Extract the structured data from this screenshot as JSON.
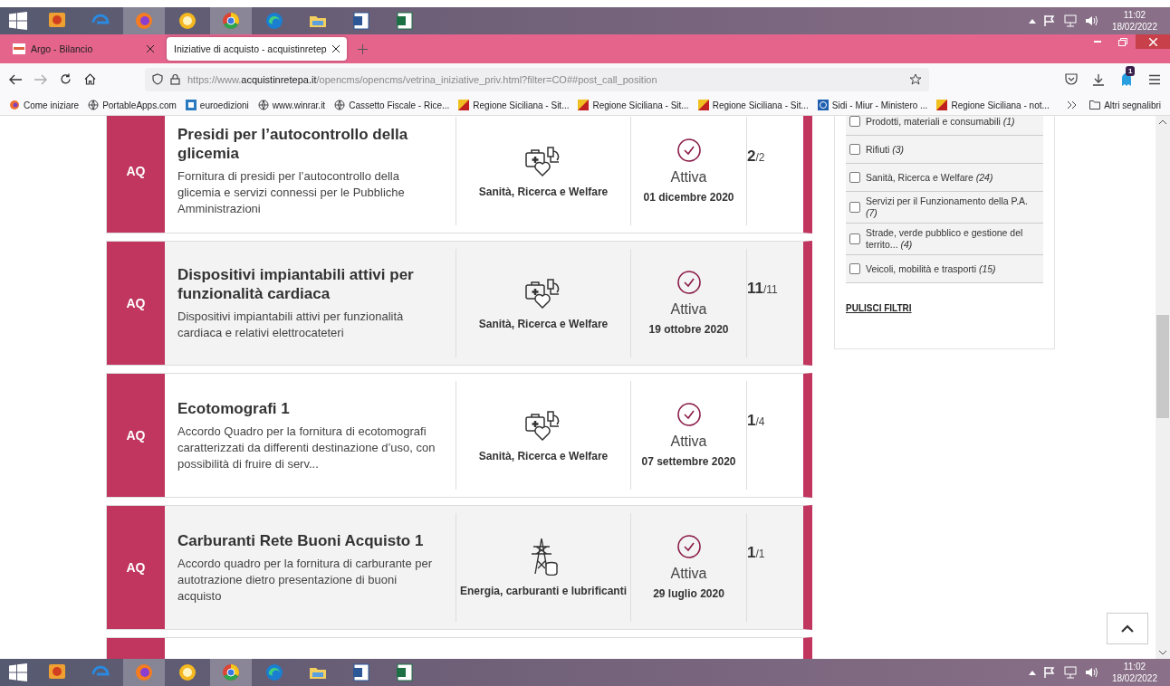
{
  "taskbars": [
    {
      "apps": [
        {
          "active": false
        },
        {
          "active": false
        },
        {
          "active": true
        },
        {
          "active": false
        },
        {
          "active": true
        },
        {
          "active": false
        },
        {
          "active": false
        },
        {
          "active": false
        },
        {
          "active": false
        }
      ],
      "time": "11:02",
      "date": "18/02/2022"
    },
    {
      "apps": [
        {
          "active": false
        },
        {
          "active": false
        },
        {
          "active": true
        },
        {
          "active": false
        },
        {
          "active": true
        },
        {
          "active": false
        },
        {
          "active": false
        },
        {
          "active": false
        },
        {
          "active": false
        }
      ],
      "time": "11:02",
      "date": "18/02/2022"
    }
  ],
  "browser": {
    "tabs": [
      {
        "title": "Argo - Bilancio",
        "selected": false
      },
      {
        "title": "Iniziative di acquisto - acquistinretep",
        "selected": true
      }
    ],
    "url": {
      "scheme": "https://www.",
      "domain": "acquistinretepa.it",
      "path": "/opencms/opencms/vetrina_iniziative_priv.html?filter=CO##post_call_position"
    },
    "extension_badge": "1",
    "bookmarks": [
      {
        "label": "Come iniziare",
        "kind": "fox"
      },
      {
        "label": "PortableApps.com",
        "kind": "globe"
      },
      {
        "label": "euroedizioni",
        "kind": "square"
      },
      {
        "label": "www.winrar.it",
        "kind": "globe"
      },
      {
        "label": "Cassetto Fiscale - Rice...",
        "kind": "globe"
      },
      {
        "label": "Regione Siciliana - Sit...",
        "kind": "region"
      },
      {
        "label": "Regione Siciliana - Sit...",
        "kind": "region"
      },
      {
        "label": "Regione Siciliana - Sit...",
        "kind": "region"
      },
      {
        "label": "Sidi - Miur - Ministero ...",
        "kind": "seal"
      },
      {
        "label": "Regione Siciliana - not...",
        "kind": "region"
      }
    ],
    "other_bookmarks": "Altri segnalibri"
  },
  "cards": [
    {
      "badge": "AQ",
      "title": "Presidi per l’autocontrollo della glicemia",
      "description": "Fornitura di presidi per l’autocontrollo della glicemia e servizi connessi per le Pubbliche Amministrazioni",
      "category": "Sanità, Ricerca e Welfare",
      "kind": "health",
      "status": "Attiva",
      "date": "01 dicembre 2020",
      "count": "2",
      "total": "/2"
    },
    {
      "badge": "AQ",
      "title": "Dispositivi impiantabili attivi per funzionalità cardiaca",
      "description": "Dispositivi impiantabili attivi per funzionalità cardiaca e relativi elettrocateteri",
      "category": "Sanità, Ricerca e Welfare",
      "kind": "health",
      "status": "Attiva",
      "date": "19 ottobre 2020",
      "count": "11",
      "total": "/11"
    },
    {
      "badge": "AQ",
      "title": "Ecotomografi 1",
      "description": "Accordo Quadro per la fornitura di ecotomografi caratterizzati da differenti destinazione d’uso, con possibilità di fruire di serv...",
      "category": "Sanità, Ricerca e Welfare",
      "kind": "health",
      "status": "Attiva",
      "date": "07 settembre 2020",
      "count": "1",
      "total": "/4"
    },
    {
      "badge": "AQ",
      "title": "Carburanti Rete Buoni Acquisto 1",
      "description": "Accordo quadro per la fornitura di carburante per autotrazione dietro presentazione di buoni acquisto",
      "category": "Energia, carburanti e lubrificanti",
      "kind": "energy",
      "status": "Attiva",
      "date": "29 luglio 2020",
      "count": "1",
      "total": "/1"
    }
  ],
  "filters": {
    "items": [
      {
        "label": "Prodotti, materiali e consumabili *(1)*",
        "checked": false
      },
      {
        "label": "Rifiuti *(3)*",
        "checked": false
      },
      {
        "label": "Sanità, Ricerca e Welfare *(24)*",
        "checked": false
      },
      {
        "label": "Servizi per il Funzionamento della P.A. *(7)*",
        "checked": false
      },
      {
        "label": "Strade, verde pubblico e gestione del territo... *(4)*",
        "checked": false
      },
      {
        "label": "Veicoli, mobilità e trasporti *(15)*",
        "checked": false
      }
    ],
    "clear": "PULISCI FILTRI"
  }
}
